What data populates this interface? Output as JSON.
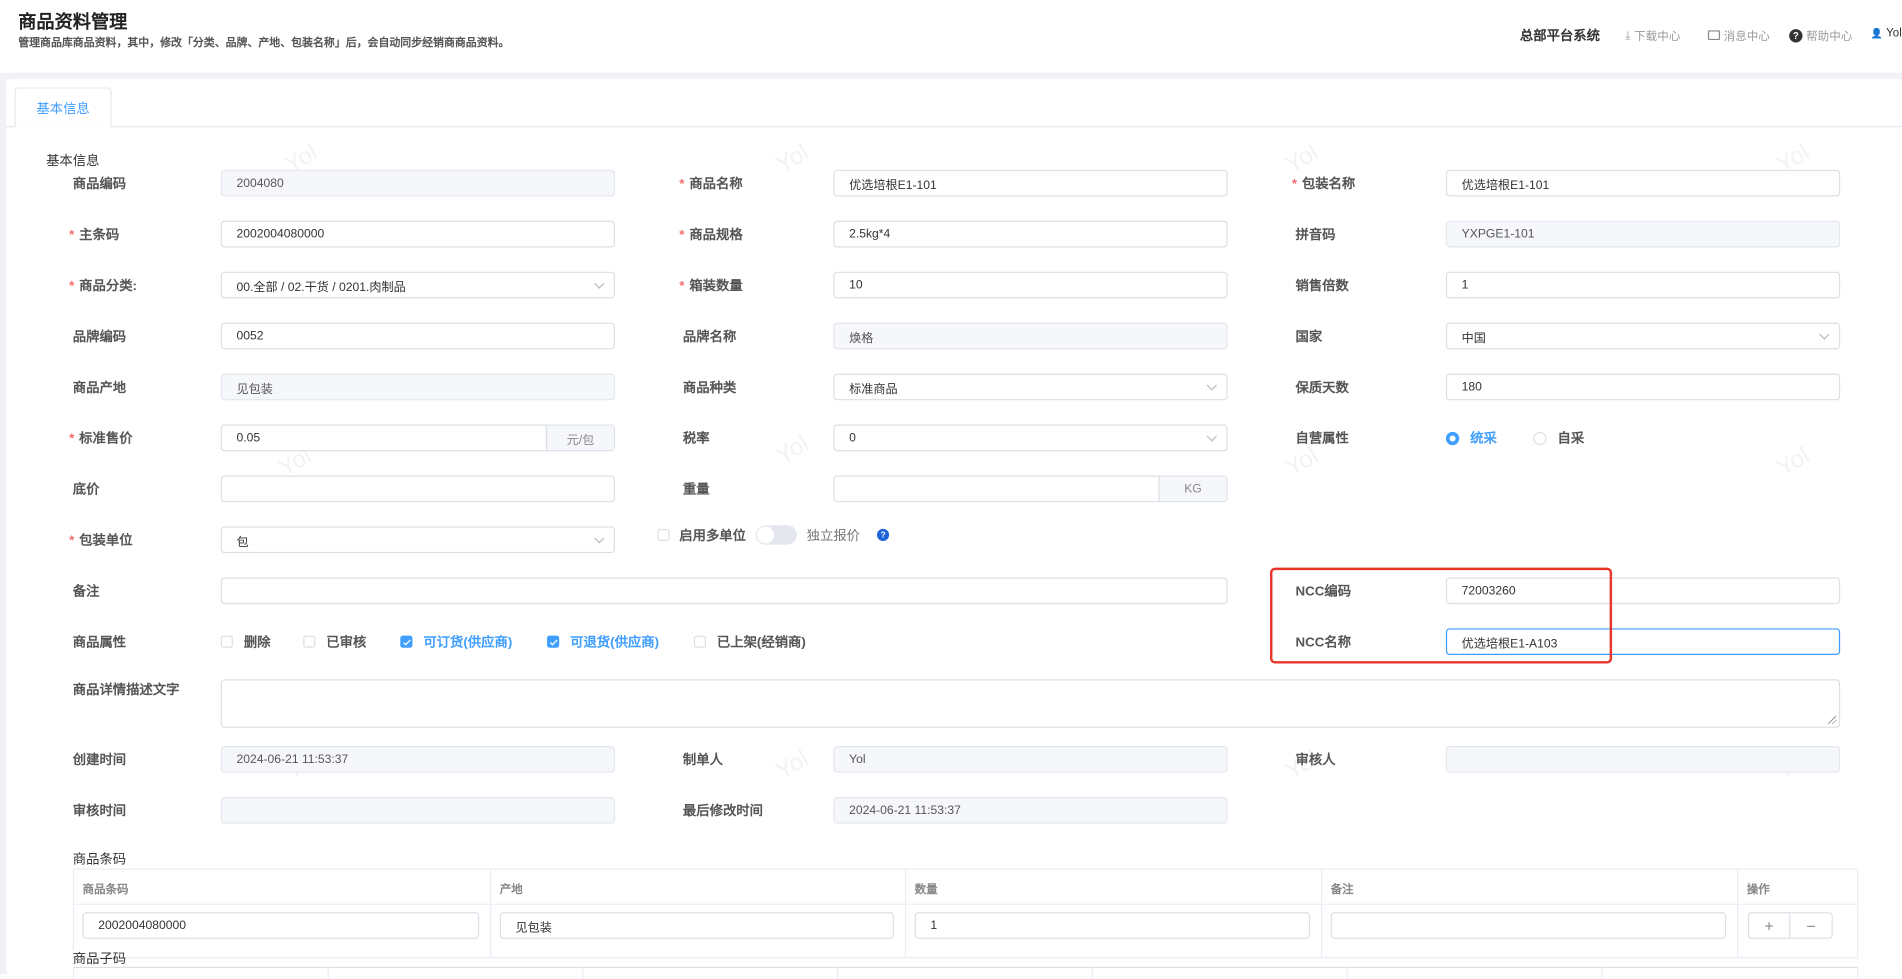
{
  "header": {
    "title": "商品资料管理",
    "subtitle": "管理商品库商品资料，其中，修改「分类、品牌、产地、包装名称」后，会自动同步经销商商品资料。",
    "system_name": "总部平台系统",
    "links": [
      {
        "icon": "download-icon",
        "label": "下载中心"
      },
      {
        "icon": "mail-icon",
        "label": "消息中心"
      },
      {
        "icon": "help-icon",
        "label": "帮助中心"
      },
      {
        "icon": "user-icon",
        "label": "Yol"
      }
    ]
  },
  "tabs": [
    {
      "label": "基本信息",
      "active": true
    }
  ],
  "section_title": "基本信息",
  "watermark": "Yol",
  "form": {
    "rows": [
      [
        {
          "label": "商品编码",
          "type": "disabled",
          "value": "2004080"
        },
        {
          "label": "商品名称",
          "required": true,
          "type": "input",
          "value": "优选培根E1-101"
        },
        {
          "label": "包装名称",
          "required": true,
          "type": "input",
          "value": "优选培根E1-101"
        }
      ],
      [
        {
          "label": "主条码",
          "required": true,
          "type": "input",
          "value": "2002004080000"
        },
        {
          "label": "商品规格",
          "required": true,
          "type": "input",
          "value": "2.5kg*4"
        },
        {
          "label": "拼音码",
          "type": "disabled",
          "value": "YXPGE1-101"
        }
      ],
      [
        {
          "label": "商品分类:",
          "required": true,
          "type": "select",
          "value": "00.全部 / 02.干货 / 0201.肉制品"
        },
        {
          "label": "箱装数量",
          "required": true,
          "type": "input",
          "value": "10"
        },
        {
          "label": "销售倍数",
          "type": "input",
          "value": "1"
        }
      ],
      [
        {
          "label": "品牌编码",
          "type": "input",
          "value": "0052"
        },
        {
          "label": "品牌名称",
          "type": "disabled",
          "value": "焕格"
        },
        {
          "label": "国家",
          "type": "select",
          "value": "中国"
        }
      ],
      [
        {
          "label": "商品产地",
          "type": "disabled",
          "value": "见包装"
        },
        {
          "label": "商品种类",
          "type": "select",
          "value": "标准商品"
        },
        {
          "label": "保质天数",
          "type": "input",
          "value": "180"
        }
      ],
      [
        {
          "label": "标准售价",
          "required": true,
          "type": "suffix",
          "value": "0.05",
          "suffix": "元/包"
        },
        {
          "label": "税率",
          "type": "select",
          "value": "0"
        },
        {
          "label": "自营属性",
          "type": "radio",
          "options": [
            {
              "label": "统采",
              "checked": true
            },
            {
              "label": "自采",
              "checked": false
            }
          ]
        }
      ],
      [
        {
          "label": "底价",
          "type": "input",
          "value": ""
        },
        {
          "label": "重量",
          "type": "suffix",
          "value": "",
          "suffix": "KG"
        },
        null
      ],
      [
        {
          "label": "包装单位",
          "required": true,
          "type": "select",
          "value": "包"
        },
        {
          "type": "multiunit",
          "checkbox_label": "启用多单位",
          "checked": false,
          "toggle_on": false,
          "toggle_label": "独立报价",
          "help": "?"
        },
        null
      ],
      [
        {
          "label": "备注",
          "type": "wide",
          "value": ""
        },
        null,
        {
          "label": "NCC编码",
          "type": "input",
          "value": "72003260"
        }
      ],
      [
        {
          "label": "商品属性",
          "type": "checkboxes",
          "options": [
            {
              "label": "删除",
              "checked": false
            },
            {
              "label": "已审核",
              "checked": false
            },
            {
              "label": "可订货(供应商)",
              "checked": true
            },
            {
              "label": "可退货(供应商)",
              "checked": true
            },
            {
              "label": "已上架(经销商)",
              "checked": false
            }
          ]
        },
        null,
        {
          "label": "NCC名称",
          "type": "focus",
          "value": "优选培根E1-A103"
        }
      ],
      [
        {
          "label": "商品详情描述文字",
          "type": "textarea",
          "value": ""
        },
        null,
        null
      ],
      [
        {
          "label": "创建时间",
          "type": "disabled",
          "value": "2024-06-21 11:53:37"
        },
        {
          "label": "制单人",
          "type": "disabled",
          "value": "Yol"
        },
        {
          "label": "审核人",
          "type": "disabled",
          "value": ""
        }
      ],
      [
        {
          "label": "审核时间",
          "type": "disabled",
          "value": ""
        },
        {
          "label": "最后修改时间",
          "type": "disabled",
          "value": "2024-06-21 11:53:37"
        },
        null
      ]
    ]
  },
  "barcode_table": {
    "title": "商品条码",
    "columns": [
      "商品条码",
      "产地",
      "数量",
      "备注",
      "操作"
    ],
    "rows": [
      {
        "barcode": "2002004080000",
        "origin": "见包装",
        "qty": "1",
        "remark": ""
      }
    ],
    "add_label": "+",
    "remove_label": "−"
  },
  "subcode_table": {
    "title": "商品子码"
  }
}
